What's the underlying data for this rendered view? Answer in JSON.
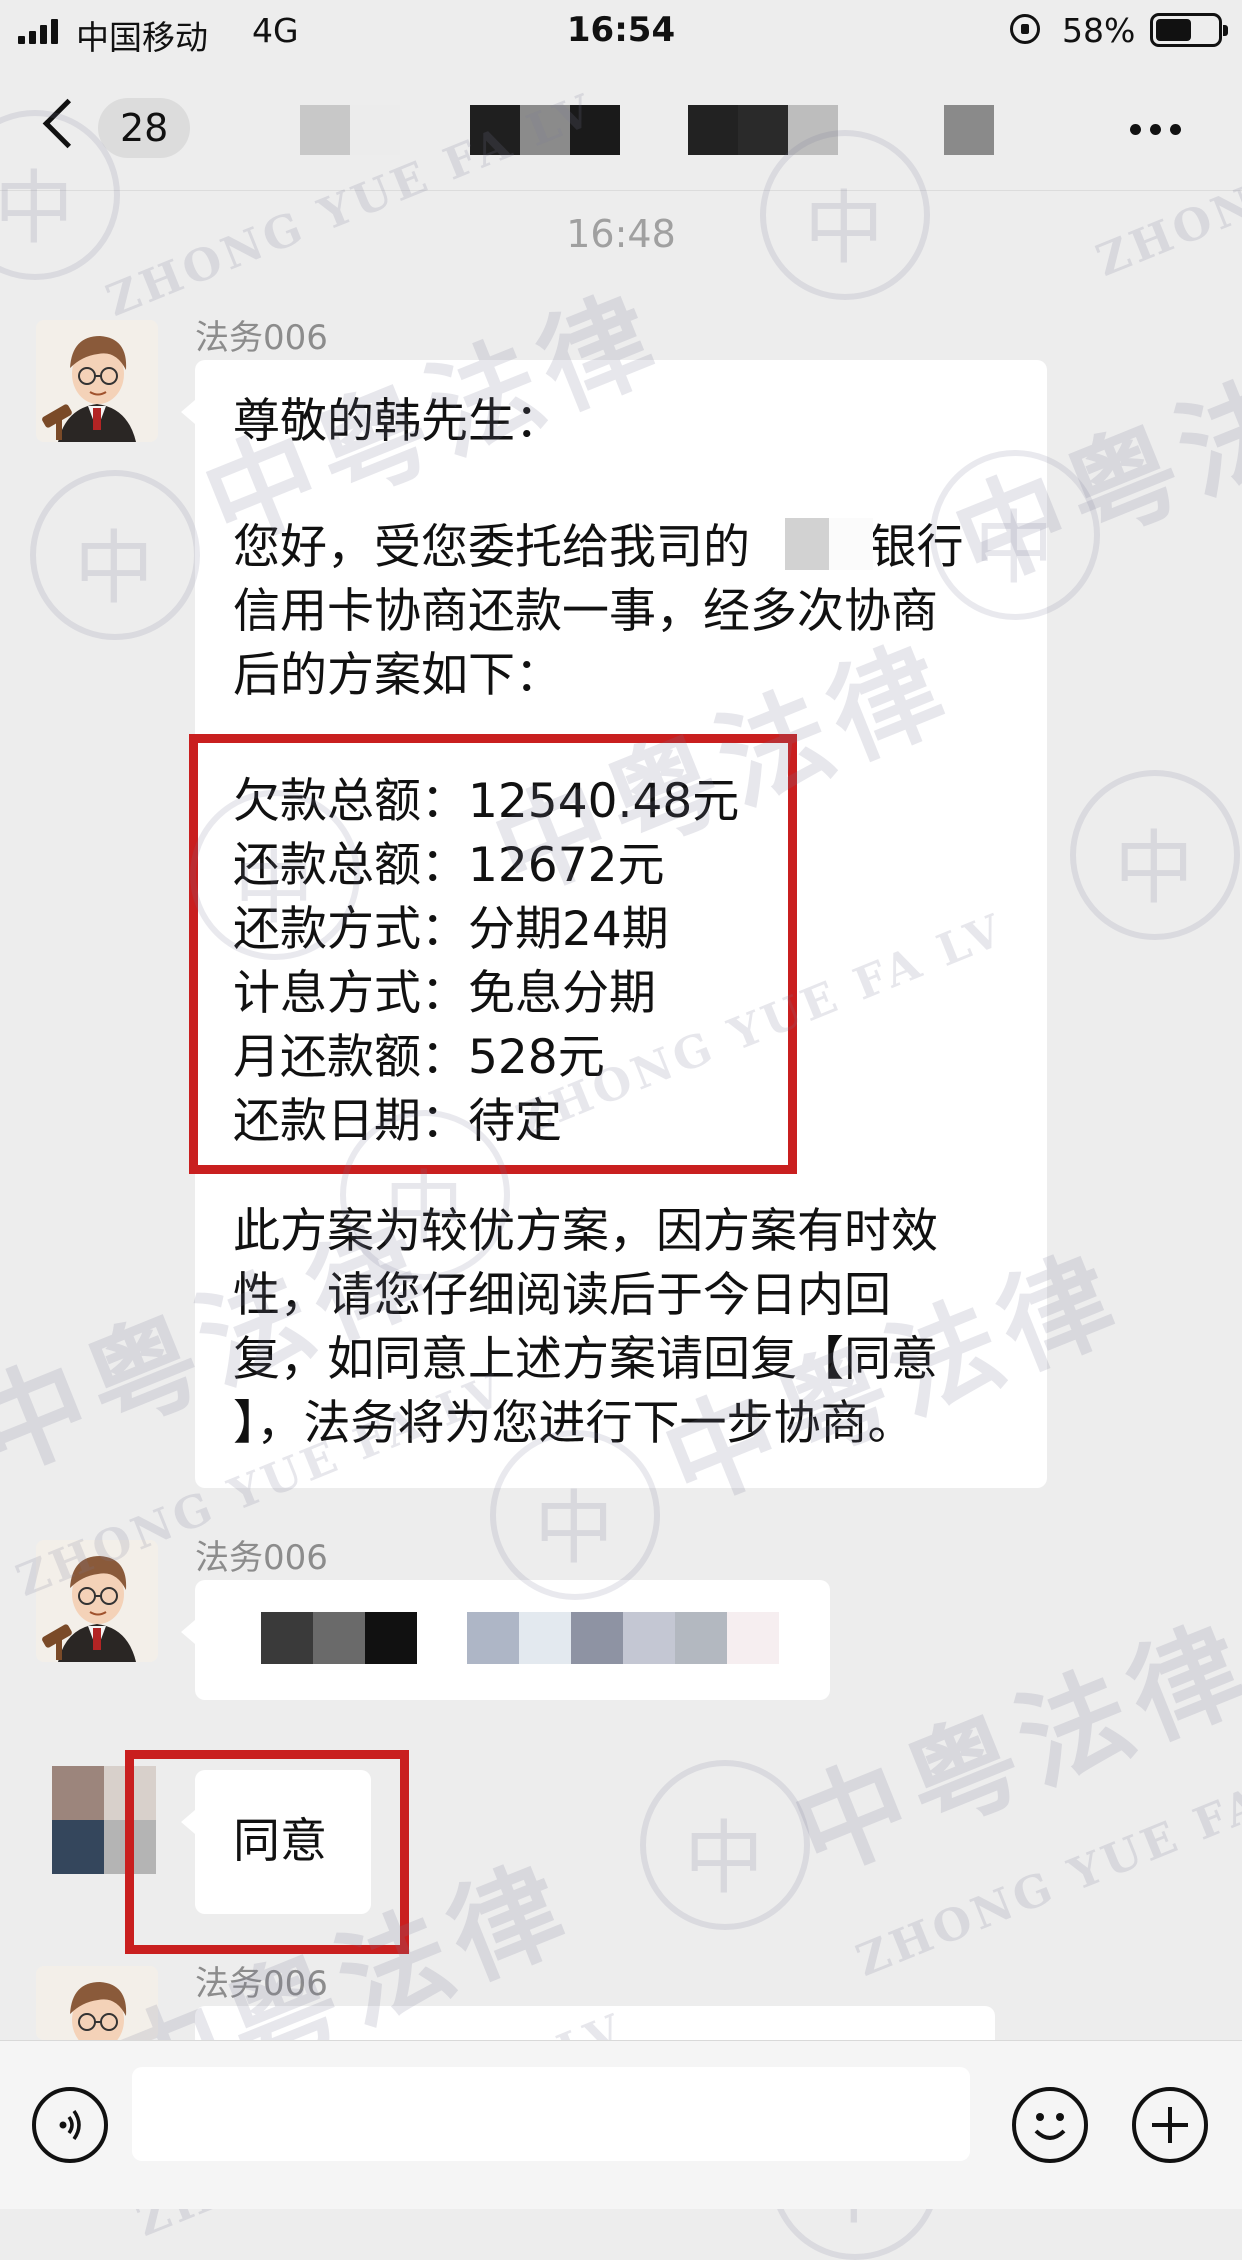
{
  "status_bar": {
    "carrier": "中国移动",
    "network": "4G",
    "time": "16:54",
    "battery": "58%",
    "battery_level": 0.58
  },
  "nav": {
    "unread_count": "28",
    "more_icon": "more-horizontal-icon",
    "back_icon": "chevron-left-icon"
  },
  "chat": {
    "timestamp": "16:48",
    "messages": [
      {
        "sender": "法务006",
        "paragraphs": [
          "尊敬的韩先生：",
          "您好，受您委托给我司的        银行\n信用卡协商还款一事，经多次协商\n后的方案如下：",
          "欠款总额：12540.48元\n还款总额：12672元\n还款方式：分期24期\n计息方式：免息分期\n月还款额：528元\n还款日期：待定",
          "此方案为较优方案，因方案有时效\n性，请您仔细阅读后于今日内回\n复，如同意上述方案请回复【同意\n】，法务将为您进行下一步协商。"
        ]
      },
      {
        "sender": "法务006"
      },
      {
        "text": "同意"
      },
      {
        "sender": "法务006"
      }
    ]
  },
  "watermark": {
    "cn": "中粤法律",
    "en": "ZHONG YUE FA LV"
  },
  "colors": {
    "background": "#ededed",
    "bubble": "#ffffff",
    "highlight_box": "#c91f1f"
  },
  "input_bar": {
    "voice_icon": "voice-icon",
    "emoji_icon": "emoji-icon",
    "plus_icon": "plus-icon"
  }
}
